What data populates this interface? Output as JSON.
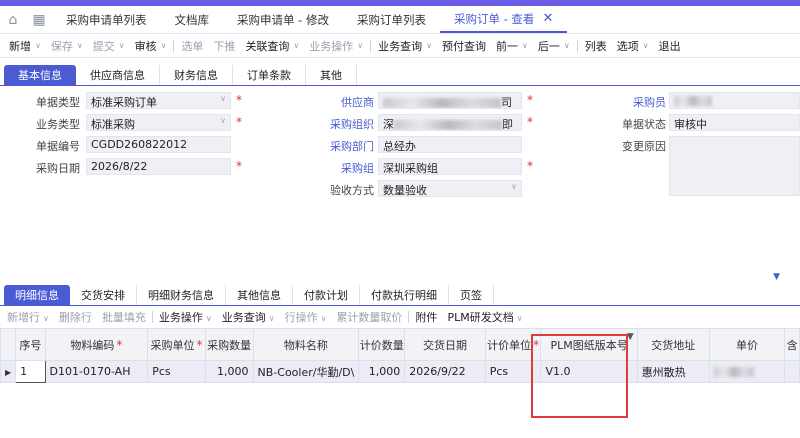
{
  "tabs": [
    "采购申请单列表",
    "文档库",
    "采购申请单 - 修改",
    "采购订单列表",
    "采购订单 - 查看"
  ],
  "toolbar": [
    {
      "label": "新增",
      "dd": true,
      "dis": false
    },
    {
      "label": "保存",
      "dd": true,
      "dis": true
    },
    {
      "label": "提交",
      "dd": true,
      "dis": true
    },
    {
      "label": "审核",
      "dd": true,
      "dis": false
    },
    {
      "sep": true
    },
    {
      "label": "选单",
      "dis": true
    },
    {
      "label": "下推",
      "dis": true
    },
    {
      "label": "关联查询",
      "dd": true,
      "dis": false
    },
    {
      "label": "业务操作",
      "dd": true,
      "dis": true
    },
    {
      "sep": true
    },
    {
      "label": "业务查询",
      "dd": true,
      "dis": false
    },
    {
      "label": "预付查询",
      "dis": false
    },
    {
      "label": "前一",
      "dd": true,
      "dis": false
    },
    {
      "label": "后一",
      "dd": true,
      "dis": false
    },
    {
      "sep": true
    },
    {
      "label": "列表",
      "dis": false
    },
    {
      "label": "选项",
      "dd": true,
      "dis": false
    },
    {
      "label": "退出",
      "dis": false
    }
  ],
  "subtabs": [
    "基本信息",
    "供应商信息",
    "财务信息",
    "订单条款",
    "其他"
  ],
  "form": {
    "doc_type_label": "单据类型",
    "doc_type": "标准采购订单",
    "biz_type_label": "业务类型",
    "biz_type": "标准采购",
    "doc_no_label": "单据编号",
    "doc_no": "CGDD260822012",
    "date_label": "采购日期",
    "date": "2026/8/22",
    "supplier_label": "供应商",
    "supplier_tail": "司",
    "org_label": "采购组织",
    "org_head": "深",
    "org_tail": "即",
    "dept_label": "采购部门",
    "dept": "总经办",
    "group_label": "采购组",
    "group": "深圳采购组",
    "accept_label": "验收方式",
    "accept": "数量验收",
    "buyer_label": "采购员",
    "status_label": "单据状态",
    "status": "审核中",
    "change_label": "变更原因"
  },
  "detail_tabs": [
    "明细信息",
    "交货安排",
    "明细财务信息",
    "其他信息",
    "付款计划",
    "付款执行明细",
    "页签"
  ],
  "detail_toolbar": [
    {
      "label": "新增行",
      "dd": true,
      "dis": true
    },
    {
      "label": "删除行",
      "dis": true
    },
    {
      "label": "批量填充",
      "dis": true
    },
    {
      "sep": true
    },
    {
      "label": "业务操作",
      "dd": true,
      "dis": false
    },
    {
      "label": "业务查询",
      "dd": true,
      "dis": false
    },
    {
      "label": "行操作",
      "dd": true,
      "dis": true
    },
    {
      "label": "累计数量取价",
      "dis": true
    },
    {
      "sep": true
    },
    {
      "label": "附件",
      "dis": false
    },
    {
      "label": "PLM研发文档",
      "dd": true,
      "dis": false
    }
  ],
  "columns": [
    "序号",
    "物料编码",
    "采购单位",
    "采购数量",
    "物料名称",
    "计价数量",
    "交货日期",
    "计价单位",
    "PLM图纸版本号",
    "交货地址",
    "单价",
    "含"
  ],
  "row": {
    "seq": "1",
    "code": "D101-0170-AH",
    "unit": "Pcs",
    "qty": "1,000",
    "name": "NB-Cooler/华勤/D\\",
    "pqty": "1,000",
    "date": "2026/9/22",
    "punit": "Pcs",
    "plm": "V1.0",
    "addr": "惠州散热"
  }
}
